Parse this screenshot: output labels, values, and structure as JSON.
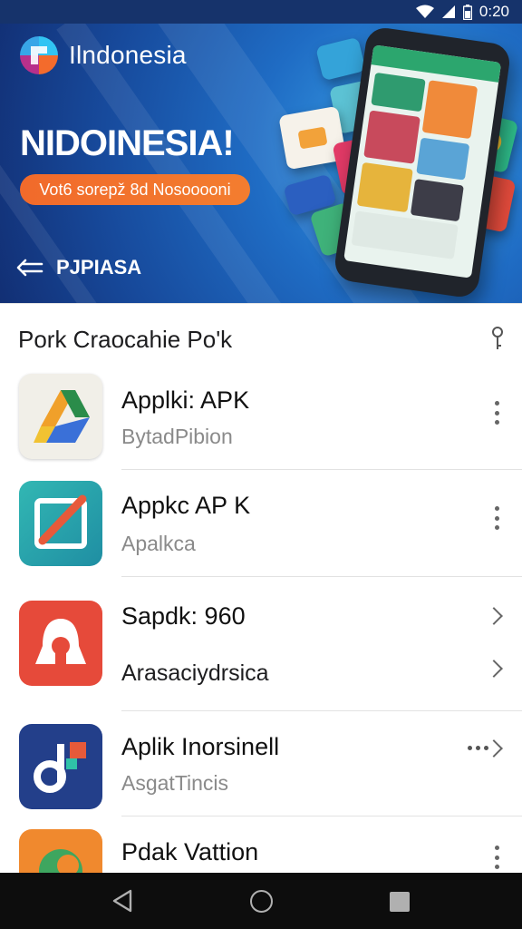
{
  "status_bar": {
    "time": "0:20",
    "icons": [
      "wifi-icon",
      "signal-icon",
      "battery-icon"
    ]
  },
  "banner": {
    "brand_name": "Ilndonesia",
    "headline": "NIDOINESIA!",
    "pill_text": "Vot6 sorepž  8d Nosooooni",
    "back_label": "PJPIASA",
    "colors": {
      "background": "#1f5fb5",
      "pill": "#f26e2c"
    }
  },
  "list": {
    "title": "Pork Craocahie Po'k",
    "items": [
      {
        "title": "Applki: APK",
        "subtitle": "BytadPibion",
        "icon": "drive-app-icon",
        "action": "more-options"
      },
      {
        "title": "Appkc AP K",
        "subtitle": "Apalkca",
        "icon": "edit-app-icon",
        "action": "more-options"
      },
      {
        "title": "Sapdk: 960",
        "subtitle": "Arasaciydrsica",
        "icon": "bell-app-icon",
        "action": "chevron"
      },
      {
        "title": "Aplik Inorsinell",
        "subtitle": "AsgatTincis",
        "icon": "music-app-icon",
        "action": "more-chevron"
      },
      {
        "title": "Pdak Vattion",
        "subtitle": "",
        "icon": "leaf-app-icon",
        "action": "more-options"
      }
    ]
  },
  "nav_bar": {
    "buttons": [
      "back-icon",
      "home-icon",
      "recents-icon"
    ]
  }
}
